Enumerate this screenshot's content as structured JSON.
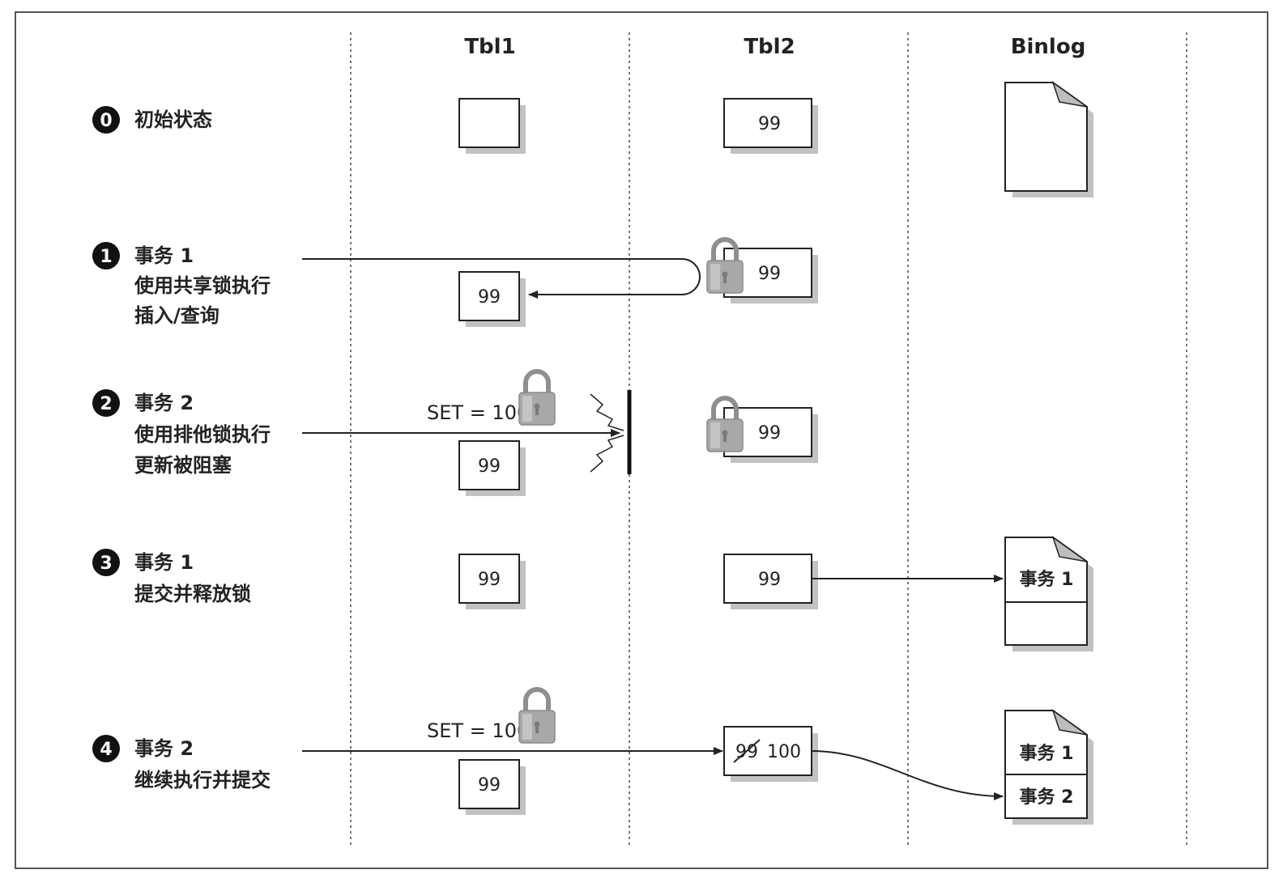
{
  "columns": {
    "tbl1": "Tbl1",
    "tbl2": "Tbl2",
    "binlog": "Binlog"
  },
  "steps": [
    {
      "num": "0",
      "lines": [
        "初始状态"
      ]
    },
    {
      "num": "1",
      "lines": [
        "事务 1",
        "使用共享锁执行",
        "插入/查询"
      ]
    },
    {
      "num": "2",
      "lines": [
        "事务 2",
        "使用排他锁执行",
        "更新被阻塞"
      ]
    },
    {
      "num": "3",
      "lines": [
        "事务 1",
        "提交并释放锁"
      ]
    },
    {
      "num": "4",
      "lines": [
        "事务 2",
        "继续执行并提交"
      ]
    }
  ],
  "values": {
    "s0_tbl1": "",
    "s0_tbl2": "99",
    "s1_tbl1": "99",
    "s1_tbl2": "99",
    "s2_tbl1": "99",
    "s2_tbl2": "99",
    "s3_tbl1": "99",
    "s3_tbl2": "99",
    "s4_tbl1": "99",
    "s4_tbl2_old": "99",
    "s4_tbl2_new": "100"
  },
  "set_labels": {
    "s2": "SET = 100",
    "s4": "SET = 100"
  },
  "binlog_entries": {
    "s3": [
      "事务 1"
    ],
    "s4": [
      "事务 1",
      "事务 2"
    ]
  },
  "colors": {
    "line": "#222222",
    "shadow": "#bdbdbd",
    "lock": "#9e9e9e",
    "badge": "#111111"
  },
  "icons": [
    "padlock-icon",
    "document-icon",
    "blocked-barrier-icon"
  ]
}
